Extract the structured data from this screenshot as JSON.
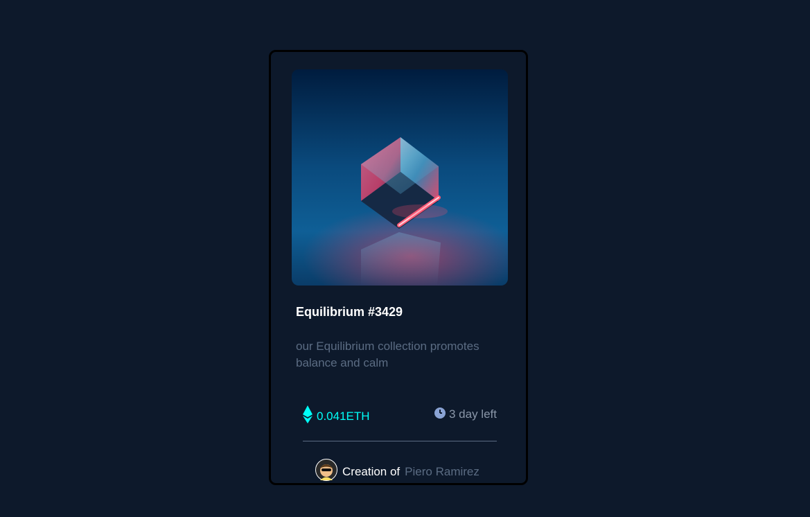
{
  "card": {
    "image_alt": "Equilibrium NFT cube image",
    "title": "Equilibrium #3429",
    "description": "our Equilibrium collection promotes balance and calm",
    "price": "0.041ETH",
    "time_left": "3 day left",
    "creator_prefix": "Creation of",
    "creator_name": "Piero Ramirez"
  },
  "colors": {
    "background": "#0d192b",
    "accent_cyan": "#00fff8",
    "muted": "#5b6c83",
    "white": "#ffffff"
  },
  "icons": {
    "price_icon": "ethereum-icon",
    "time_icon": "clock-icon",
    "avatar": "creator-avatar"
  }
}
